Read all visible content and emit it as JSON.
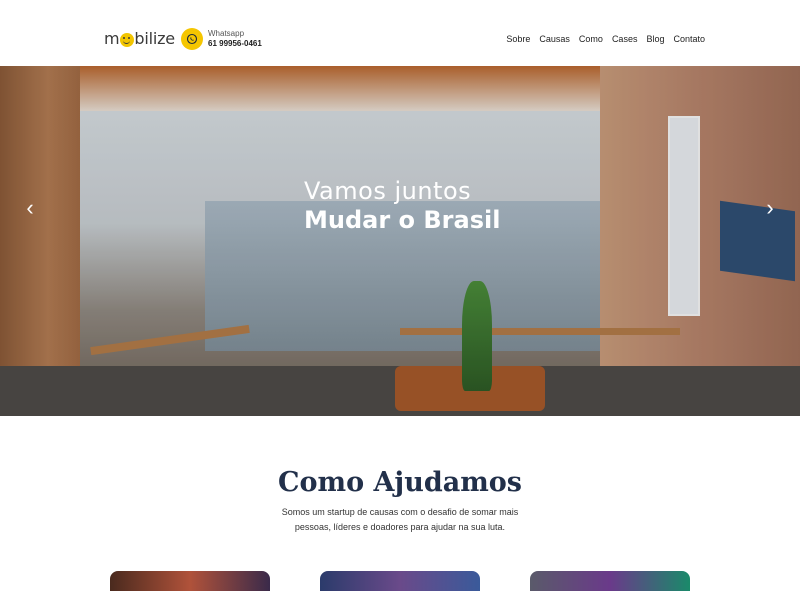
{
  "header": {
    "logo_prefix": "m",
    "logo_suffix": "bilize",
    "whatsapp_label": "Whatsapp",
    "whatsapp_number": "61 99956-0461",
    "nav": [
      "Sobre",
      "Causas",
      "Como",
      "Cases",
      "Blog",
      "Contato"
    ]
  },
  "hero": {
    "line1": "Vamos juntos",
    "line2": "Mudar o Brasil"
  },
  "section": {
    "title": "Como Ajudamos",
    "description": "Somos um startup de causas com o desafio de somar mais pessoas, líderes e doadores para ajudar na sua luta."
  },
  "colors": {
    "brand_yellow": "#f5c600",
    "title_navy": "#22304a"
  }
}
